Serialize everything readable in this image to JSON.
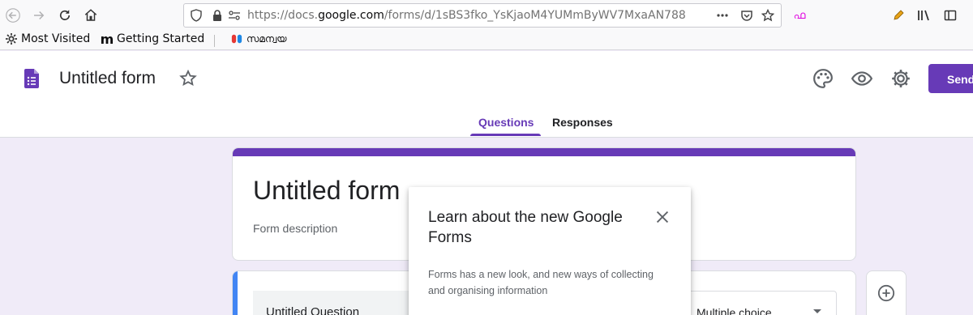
{
  "browser": {
    "url_prefix": "https://docs.",
    "url_host": "google.com",
    "url_path": "/forms/d/1sBS3fko_YsKjaoM4YUMmByWV7MxaAN788",
    "extension_label": "ഫ",
    "bookmarks": [
      {
        "label": "Most Visited",
        "icon": "gear-icon"
      },
      {
        "label": "Getting Started",
        "icon": "m-logo-icon"
      },
      {
        "label": "സമന്വയ",
        "icon": "bookmark-favicon-icon"
      }
    ]
  },
  "forms_header": {
    "doc_title": "Untitled form",
    "send_label": "Send",
    "tabs": [
      {
        "label": "Questions",
        "active": true
      },
      {
        "label": "Responses",
        "active": false
      }
    ]
  },
  "form": {
    "title": "Untitled form",
    "description_placeholder": "Form description",
    "question": {
      "title": "Untitled Question",
      "type": "Multiple choice"
    }
  },
  "popup": {
    "title": "Learn about the new Google Forms",
    "body": "Forms has a new look, and new ways of collecting and organising information"
  },
  "colors": {
    "accent": "#673ab7",
    "background": "#f0ebf8",
    "question_highlight": "#4285f4"
  }
}
